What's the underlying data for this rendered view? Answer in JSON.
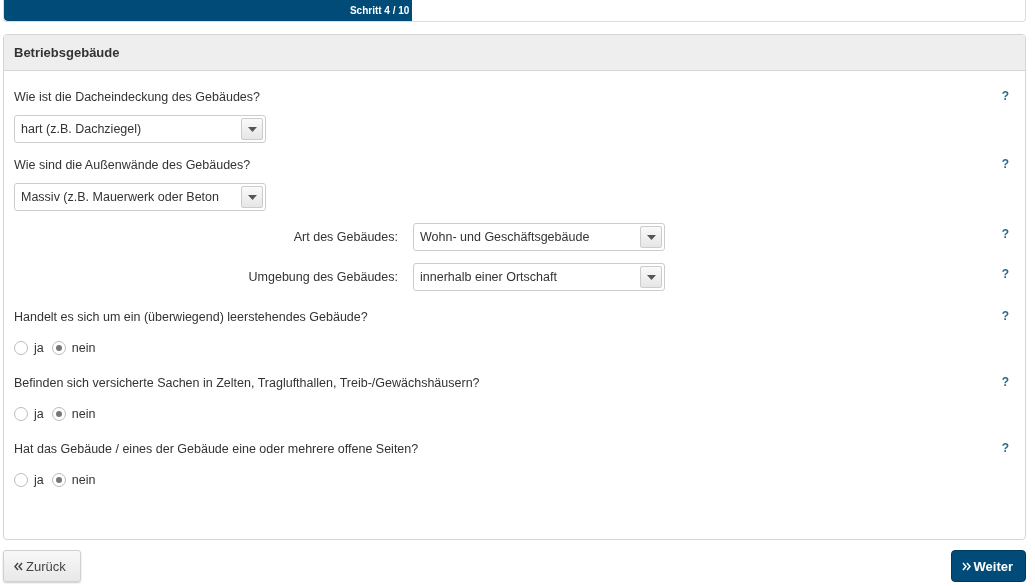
{
  "progress": {
    "label": "Schritt 4 / 10",
    "level": 0.4
  },
  "panel": {
    "title": "Betriebsgebäude",
    "questions": [
      {
        "kind": "select",
        "label": "Wie ist die Dacheindeckung des Gebäudes?",
        "value": "hart (z.B. Dachziegel)",
        "help": "?"
      },
      {
        "kind": "select",
        "label": "Wie sind die Außenwände des Gebäudes?",
        "value": "Massiv (z.B. Mauerwerk oder Beton",
        "help": "?"
      },
      {
        "kind": "inline-select",
        "label": "Art des Gebäudes:",
        "value": "Wohn- und Geschäftsgebäude",
        "help": "?"
      },
      {
        "kind": "inline-select",
        "label": "Umgebung des Gebäudes:",
        "value": "innerhalb einer Ortschaft",
        "help": "?"
      },
      {
        "kind": "radio",
        "label": "Handelt es sich um ein (überwiegend) leerstehendes Gebäude?",
        "help": "?",
        "options": [
          {
            "label": "ja",
            "selected": false
          },
          {
            "label": "nein",
            "selected": true
          }
        ]
      },
      {
        "kind": "radio",
        "label": "Befinden sich versicherte Sachen in Zelten, Traglufthallen, Treib-/Gewächshäusern?",
        "help": "?",
        "options": [
          {
            "label": "ja",
            "selected": false
          },
          {
            "label": "nein",
            "selected": true
          }
        ]
      },
      {
        "kind": "radio",
        "label": "Hat das Gebäude / eines der Gebäude eine oder mehrere offene Seiten?",
        "help": "?",
        "options": [
          {
            "label": "ja",
            "selected": false
          },
          {
            "label": "nein",
            "selected": true
          }
        ]
      }
    ]
  },
  "buttons": {
    "back": "Zurück",
    "next": "Weiter"
  }
}
